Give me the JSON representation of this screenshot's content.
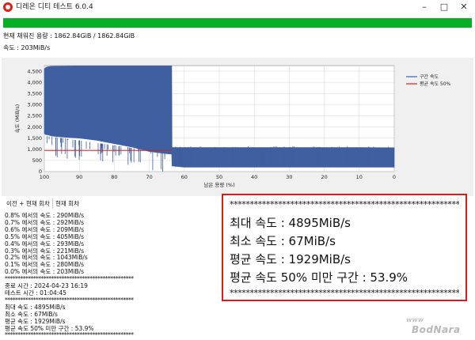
{
  "window": {
    "title": "디레온 디티 테스트 6.0.4",
    "controls": {
      "minimize": "–",
      "maximize": "□",
      "close": "✕"
    }
  },
  "progress": {
    "percent": 100,
    "color": "#06b025"
  },
  "status": {
    "written": "현재 채워진 용량 : 1862.84GiB / 1862.84GiB",
    "speed": "속도 : 203MiB/s"
  },
  "chart_data": {
    "type": "area",
    "xlabel": "남은 용량 (%)",
    "ylabel": "속도 (MiB/s)",
    "xlim": [
      100,
      0
    ],
    "ylim": [
      0,
      4750
    ],
    "x_ticks": [
      100,
      90,
      80,
      70,
      60,
      50,
      40,
      30,
      20,
      10,
      0
    ],
    "y_ticks": [
      0,
      500,
      1000,
      1500,
      2000,
      2500,
      3000,
      3500,
      4000,
      4500
    ],
    "y_tick_labels": [
      "0",
      "500",
      "1,000",
      "1,500",
      "2,000",
      "2,500",
      "3,000",
      "3,500",
      "4,000",
      "4,500"
    ],
    "grid": true,
    "legend_position": "top-right",
    "series": [
      {
        "name": "구간 속도",
        "color": "#3f5fa0",
        "x": [
          100,
          99.5,
          99,
          98,
          95,
          90,
          85,
          80,
          75,
          70,
          65,
          63.6,
          63.5,
          60,
          50,
          40,
          30,
          20,
          10,
          0
        ],
        "top": [
          4600,
          4680,
          4700,
          4720,
          4730,
          4740,
          4740,
          4740,
          4740,
          4740,
          4740,
          4740,
          1080,
          1080,
          1080,
          1080,
          1080,
          1080,
          1080,
          1070
        ],
        "bottom": [
          1700,
          1650,
          1650,
          1600,
          1550,
          1500,
          1400,
          1250,
          1100,
          900,
          800,
          780,
          250,
          200,
          200,
          200,
          200,
          200,
          200,
          200
        ]
      },
      {
        "name": "평균 속도 50%",
        "color": "#d62020",
        "x": [
          100,
          63.5
        ],
        "y": [
          950,
          950
        ]
      }
    ]
  },
  "tabs": [
    {
      "label": "이전 + 현재 회차"
    },
    {
      "label": "현재 회차"
    }
  ],
  "log": {
    "speed_lines": [
      "0.8% 에서의 속도 : 290MiB/s",
      "0.7% 에서의 속도 : 292MiB/s",
      "0.6% 에서의 속도 : 209MiB/s",
      "0.5% 에서의 속도 : 405MiB/s",
      "0.4% 에서의 속도 : 293MiB/s",
      "0.3% 에서의 속도 : 221MiB/s",
      "0.2% 에서의 속도 : 1043MiB/s",
      "0.1% 에서의 속도 : 280MiB/s",
      "0.0% 에서의 속도 : 203MiB/s"
    ],
    "stars": "**************************************************",
    "end_time": "종료 시간 : 2024-04-23 16:19",
    "elapsed": "테스트 시간 : 01:04:45",
    "summary_lines": [
      "최대 속도 : 4895MiB/s",
      "최소 속도 : 67MiB/s",
      "평균 속도 : 1929MiB/s",
      "평균 속도 50% 미만 구간 : 53.9%"
    ]
  },
  "callout": {
    "border_color": "#d91e18",
    "stars": "********************************************************************",
    "max": "최대 속도 : 4895MiB/s",
    "min": "최소 속도 : 67MiB/s",
    "avg": "평균 속도 : 1929MiB/s",
    "below_half": "평균 속도 50% 미만 구간 : 53.9%"
  },
  "watermark": {
    "main": "BodNara",
    "sub": "www"
  }
}
